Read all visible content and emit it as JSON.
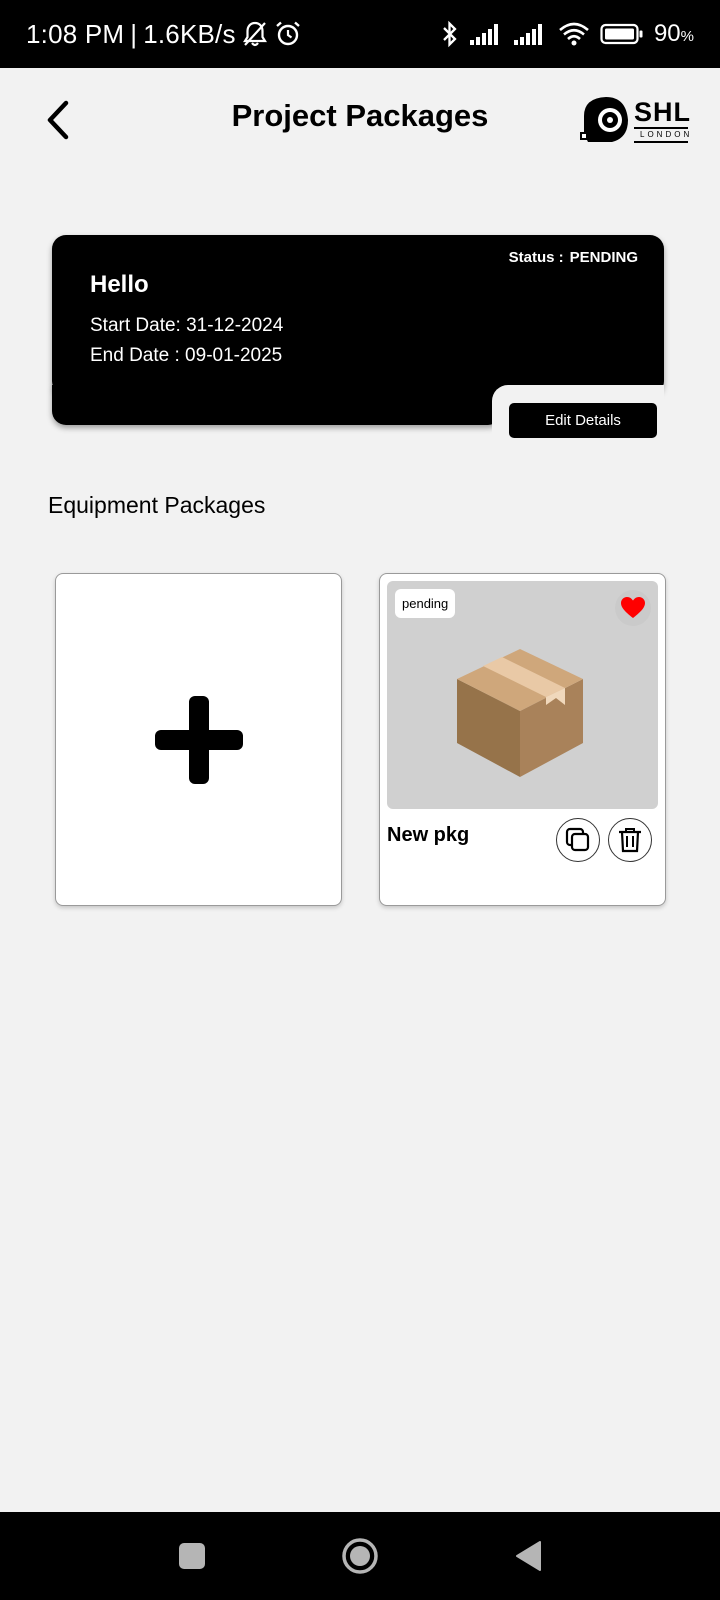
{
  "status_bar": {
    "time": "1:08 PM",
    "separator": "|",
    "network_speed": "1.6KB/s",
    "battery_percent": "90",
    "battery_unit": "%",
    "icons": [
      "bell-off-icon",
      "alarm-icon",
      "bluetooth-icon",
      "signal-icon",
      "signal-icon",
      "wifi-icon",
      "battery-icon"
    ]
  },
  "header": {
    "title": "Project Packages",
    "back_icon": "chevron-left-icon",
    "logo": {
      "text": "SHL",
      "subtext": "LONDON"
    }
  },
  "project": {
    "name": "Hello",
    "status_label": "Status :",
    "status_value": "PENDING",
    "start_date": "Start Date: 31-12-2024",
    "end_date": "End Date : 09-01-2025",
    "edit_label": "Edit Details"
  },
  "section": {
    "title": "Equipment Packages"
  },
  "packages": {
    "add_icon": "plus-icon",
    "items": [
      {
        "name": "New pkg",
        "badge": "pending",
        "favorite": true,
        "icons": [
          "heart-icon",
          "box-icon",
          "copy-icon",
          "trash-icon"
        ]
      }
    ]
  },
  "nav_bar": {
    "icons": [
      "recents-square-icon",
      "home-circle-icon",
      "back-triangle-icon"
    ]
  },
  "colors": {
    "background": "#f2f2f2",
    "card": "#000000",
    "heart": "#ff0000",
    "image_bg": "#d0d0d0"
  }
}
